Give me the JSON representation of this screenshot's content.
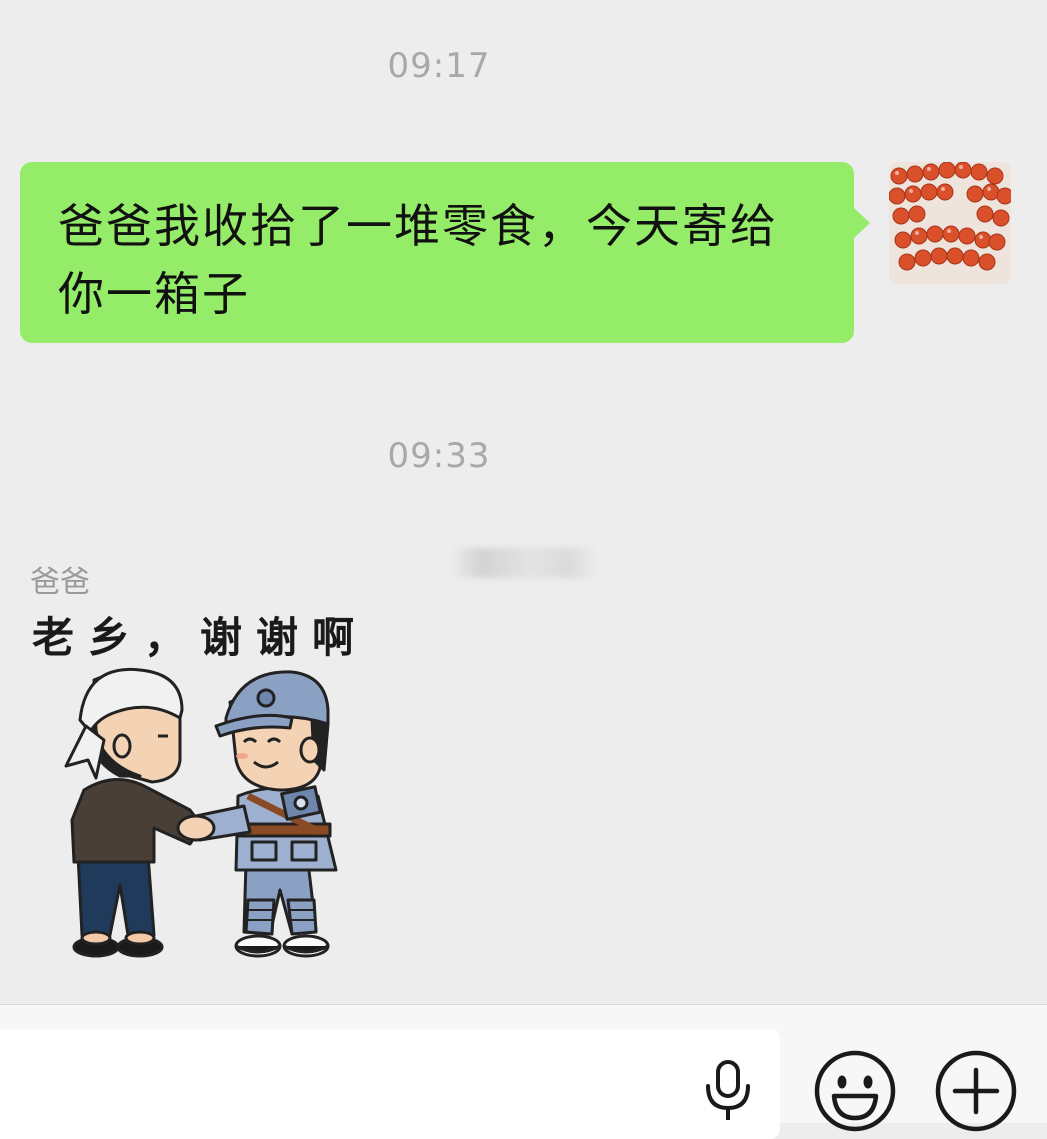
{
  "timestamps": [
    "09:17",
    "09:33"
  ],
  "messages": {
    "outgoing": {
      "text_line1": "爸爸我收拾了一堆零食，今天寄给",
      "text_line2": "你一箱子"
    },
    "incoming": {
      "sender": "爸爸",
      "sticker_caption": "老乡，谢谢啊"
    }
  },
  "input_bar": {
    "voice_icon": "microphone-icon",
    "emoji_icon": "smiley-icon",
    "more_icon": "plus-circle-icon"
  },
  "colors": {
    "background": "#ededed",
    "outgoing_bubble": "#95ec69",
    "timestamp_text": "#a8a8a8"
  }
}
